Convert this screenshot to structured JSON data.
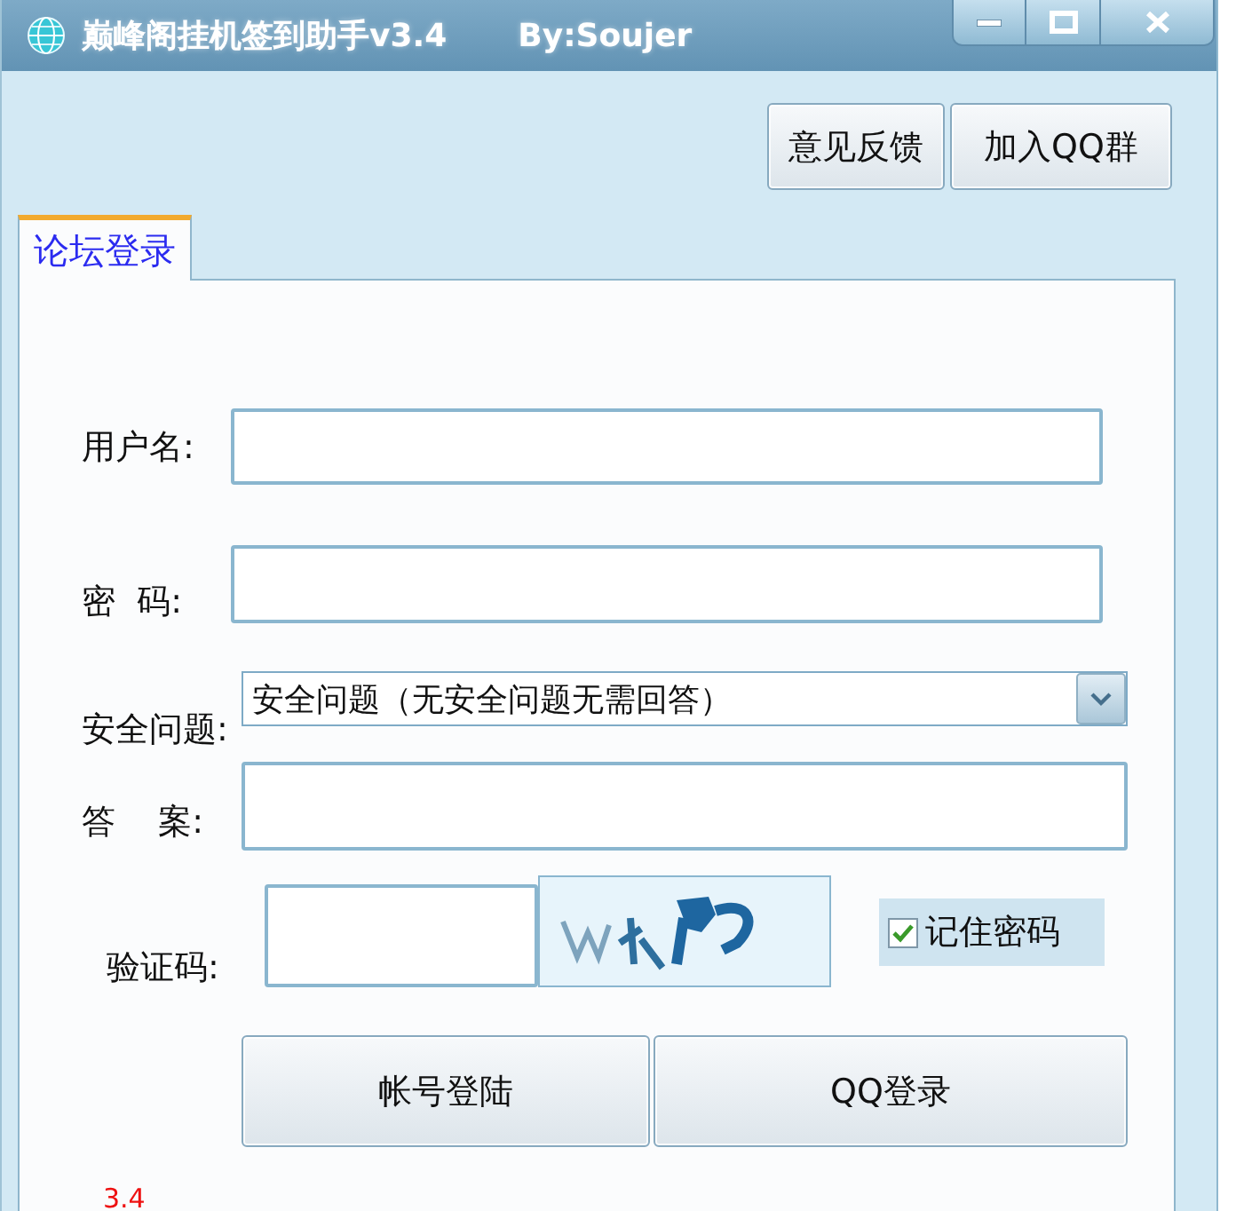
{
  "window": {
    "title": "巅峰阁挂机签到助手v3.4",
    "author": "By:Soujer"
  },
  "header_buttons": [
    "意见反馈",
    "加入QQ群"
  ],
  "tabs": [
    {
      "label": "论坛登录",
      "selected": true
    }
  ],
  "form": {
    "fields": [
      {
        "kind": "text",
        "label": "用户名:"
      },
      {
        "kind": "password",
        "label": "密  码:"
      },
      {
        "kind": "select",
        "label": "安全问题:",
        "value": "安全问题（无安全问题无需回答）"
      },
      {
        "kind": "text",
        "label": "答    案:"
      },
      {
        "kind": "captcha",
        "label": "验证码:"
      }
    ],
    "remember": {
      "label": "记住密码",
      "checked": true
    },
    "buttons": [
      "帐号登陆",
      "QQ登录"
    ]
  },
  "version": "3.4"
}
